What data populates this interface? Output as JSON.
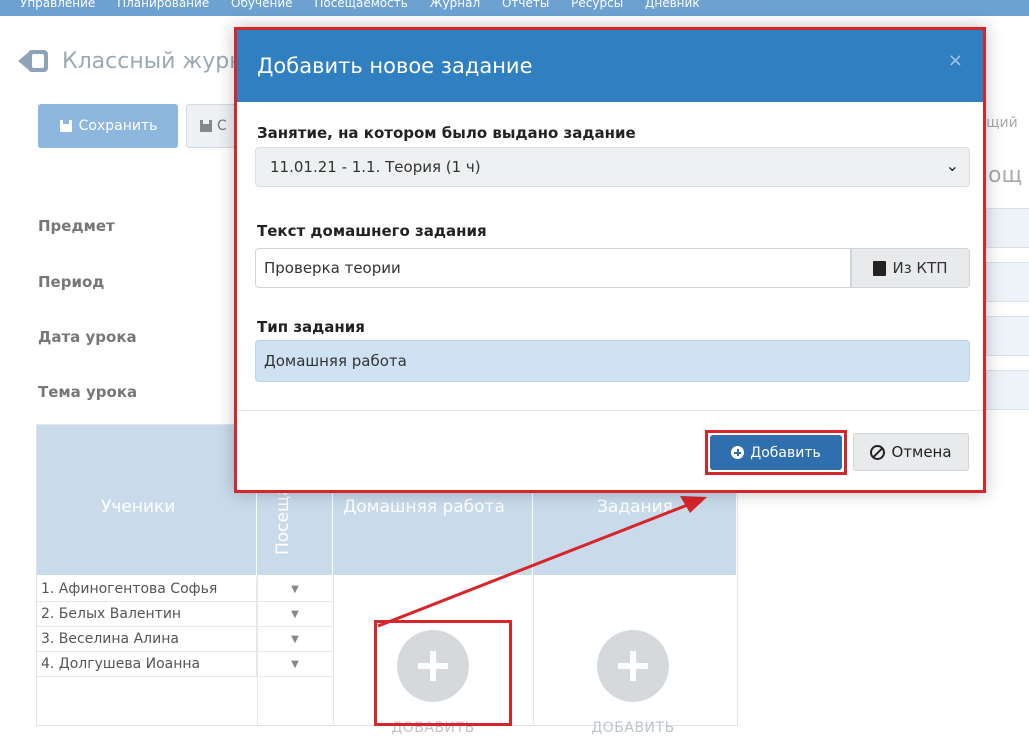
{
  "top_nav": [
    "Управление",
    "Планирование",
    "Обучение",
    "Посещаемость",
    "Журнал",
    "Отчеты",
    "Ресурсы",
    "Дневник"
  ],
  "page": {
    "title": "Классный журнал",
    "save_button": "Сохранить",
    "second_button": "С",
    "right_text": "ущий",
    "right_title": "ощ"
  },
  "form_labels": {
    "subject": "Предмет",
    "period": "Период",
    "lesson_date": "Дата урока",
    "lesson_topic": "Тема урока"
  },
  "table": {
    "headers": {
      "students": "Ученики",
      "attendance": "Посещаемость",
      "homework": "Домашняя работа",
      "tasks": "Задания"
    },
    "students": [
      "1. Афиногентова Софья",
      "2. Белых Валентин",
      "3. Веселина Алина",
      "4. Долгушева Иоанна"
    ],
    "add_label": "ДОБАВИТЬ"
  },
  "modal": {
    "title": "Добавить новое задание",
    "close": "×",
    "lesson_label": "Занятие, на котором было выдано задание",
    "lesson_value": "11.01.21 - 1.1. Теория (1 ч)",
    "text_label": "Текст домашнего задания",
    "text_value": "Проверка теории",
    "ktp_button": "Из КТП",
    "type_label": "Тип задания",
    "type_value": "Домашняя работа",
    "add_button": "Добавить",
    "cancel_button": "Отмена"
  },
  "colors": {
    "modal_header": "#2f7fc1",
    "highlight": "#d7262b",
    "type_field": "#cfe2f3"
  }
}
